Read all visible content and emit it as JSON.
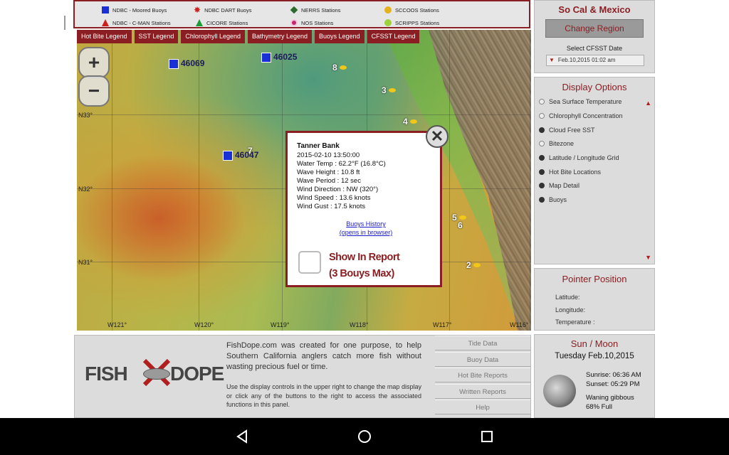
{
  "legend": {
    "items": [
      {
        "label": "NDBC - Moored Buoys",
        "icon": "blue-square-icon"
      },
      {
        "label": "NDBC DART Buoys",
        "icon": "red-star-icon"
      },
      {
        "label": "NERRS Stations",
        "icon": "green-diamond-icon"
      },
      {
        "label": "SCCOOS Stations",
        "icon": "yellow-circle-icon"
      },
      {
        "label": "NDBC - C-MAN Stations",
        "icon": "red-triangle-icon"
      },
      {
        "label": "CICORE Stations",
        "icon": "green-triangle-icon"
      },
      {
        "label": "NOS Stations",
        "icon": "pink-circle-icon"
      },
      {
        "label": "SCRIPPS Stations",
        "icon": "green-circle-icon"
      }
    ],
    "tabs": [
      "Hot Bite Legend",
      "SST Legend",
      "Chlorophyll Legend",
      "Bathymetry Legend",
      "Buoys Legend",
      "CFSST Legend"
    ]
  },
  "map": {
    "zoom_in": "+",
    "zoom_out": "−",
    "lat_labels": [
      "N33°",
      "N32°",
      "N31°"
    ],
    "lon_labels": [
      "W121°",
      "W120°",
      "W119°",
      "W118°",
      "W117°",
      "W116°"
    ],
    "buoys": [
      "46069",
      "46025",
      "46047"
    ],
    "hot_bite_numbers": [
      "8",
      "3",
      "4",
      "7",
      "5",
      "6",
      "2"
    ]
  },
  "popup": {
    "station": "Tanner Bank",
    "datetime": "2015-02-10 13:50:00",
    "water_temp": "Water Temp : 62.2°F (16.8°C)",
    "wave_height": "Wave Height : 10.8 ft",
    "wave_period": "Wave Period : 12 sec",
    "wind_direction": "Wind Direction : NW (320°)",
    "wind_speed": "Wind Speed : 13.6 knots",
    "wind_gust": "Wind Gust : 17.5 knots",
    "history_link": "Buoys History",
    "history_note": "(opens in browser)",
    "report_line1": "Show In Report",
    "report_line2": "(3 Bouys Max)",
    "close": "✕"
  },
  "region": {
    "title": "So Cal & Mexico",
    "change_button": "Change Region",
    "cfsst_label": "Select CFSST Date",
    "cfsst_value": "Feb.10,2015 01:02 am"
  },
  "display_options": {
    "title": "Display Options",
    "options": [
      {
        "label": "Sea Surface Temperature",
        "selected": false
      },
      {
        "label": "Chlorophyll Concentration",
        "selected": false
      },
      {
        "label": "Cloud Free SST",
        "selected": true
      },
      {
        "label": "Bitezone",
        "selected": false
      },
      {
        "label": "Latitude / Longitude Grid",
        "selected": true
      },
      {
        "label": "Hot Bite Locations",
        "selected": true
      },
      {
        "label": "Map Detail",
        "selected": true
      },
      {
        "label": "Buoys",
        "selected": true
      }
    ]
  },
  "pointer": {
    "title": "Pointer Position",
    "latitude": "Latitude:",
    "longitude": "Longitude:",
    "temperature": "Temperature :"
  },
  "sunmoon": {
    "title": "Sun / Moon",
    "date": "Tuesday Feb.10,2015",
    "sunrise": "Sunrise: 06:36 AM",
    "sunset": "Sunset: 05:29 PM",
    "phase": "Waning gibbous",
    "illumination": "68% Full"
  },
  "info": {
    "logo_text_left": "FISH",
    "logo_text_right": "DOPE",
    "description": "FishDope.com was created for one purpose, to help Southern California anglers catch more fish without wasting precious fuel or time.",
    "instructions": "Use the display controls in the upper right to change the map display or click any of the buttons to the right to access the associated functions in this panel.",
    "buttons": [
      "Tide Data",
      "Buoy Data",
      "Hot Bite Reports",
      "Written Reports",
      "Help"
    ]
  }
}
